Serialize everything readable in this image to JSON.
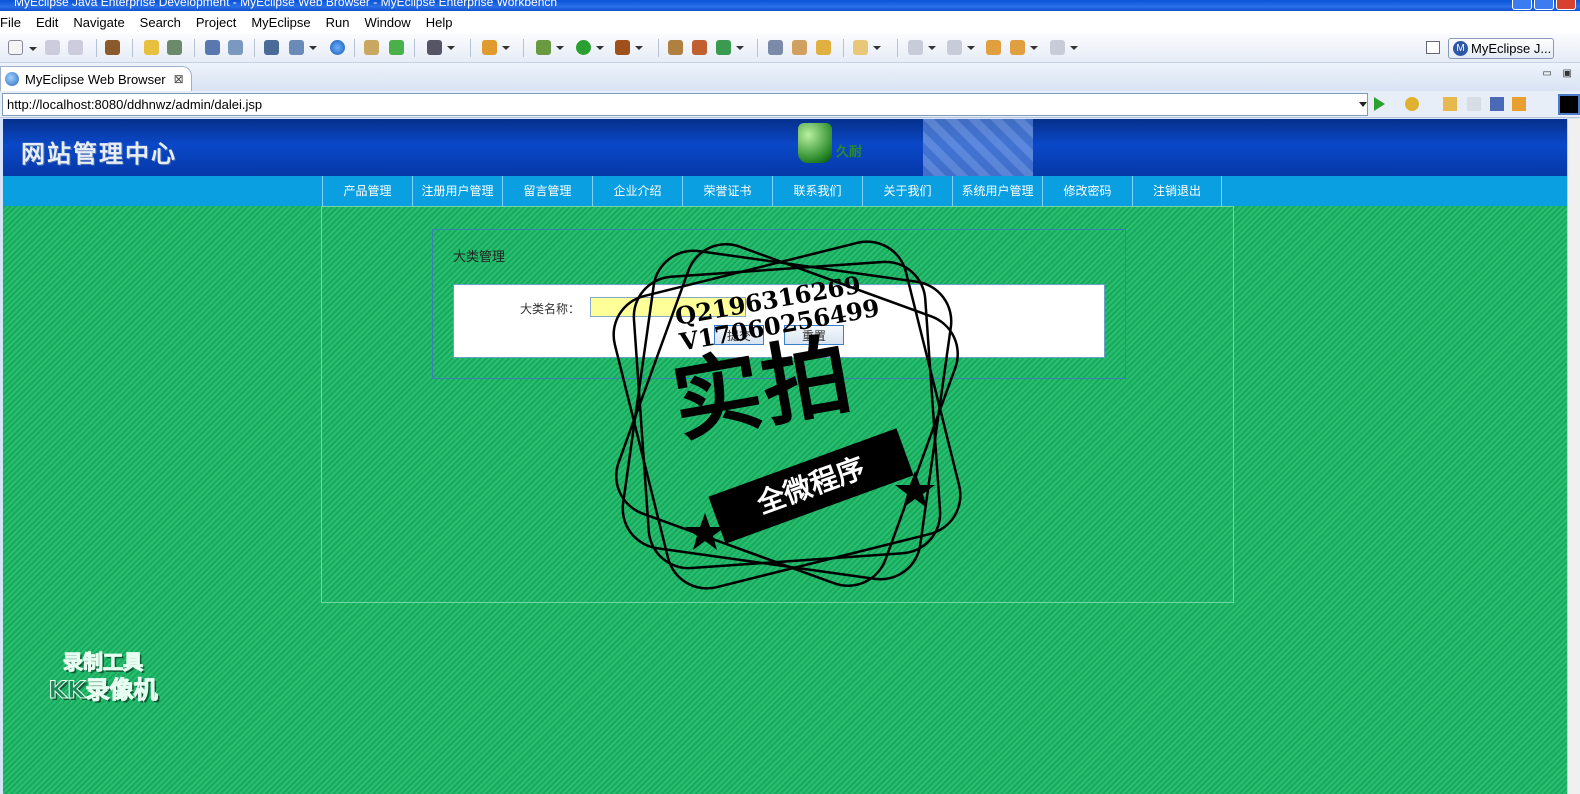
{
  "window": {
    "title": "MyEclipse Java Enterprise Development - MyEclipse Web Browser - MyEclipse Enterprise Workbench"
  },
  "menu": [
    "File",
    "Edit",
    "Navigate",
    "Search",
    "Project",
    "MyEclipse",
    "Run",
    "Window",
    "Help"
  ],
  "perspective": {
    "label": "MyEclipse J...",
    "badge": "M"
  },
  "editor_tab": {
    "label": "MyEclipse Web Browser",
    "close_glyph": "⊠"
  },
  "address": {
    "url": "http://localhost:8080/ddhnwz/admin/dalei.jsp"
  },
  "site": {
    "title": "网站管理中心",
    "logo_text": "久耐",
    "nav": [
      "产品管理",
      "注册用户管理",
      "留言管理",
      "企业介绍",
      "荣誉证书",
      "联系我们",
      "关于我们",
      "系统用户管理",
      "修改密码",
      "注销退出"
    ],
    "section_title": "大类管理",
    "form": {
      "label": "大类名称：",
      "input_value": "",
      "submit_label": "提交",
      "reset_label": "重置"
    }
  },
  "overlay": {
    "contact_q": "Q2196316269",
    "contact_v": "V17060256499",
    "stamp_main": "实拍",
    "stamp_banner": "全微程序",
    "watermark_line1": "录制工具",
    "watermark_line2": "KK录像机"
  },
  "colors": {
    "header_blue": "#0a48c8",
    "nav_blue": "#0a9fe0",
    "page_green": "#27c06f",
    "input_yellow": "#ffff99"
  }
}
